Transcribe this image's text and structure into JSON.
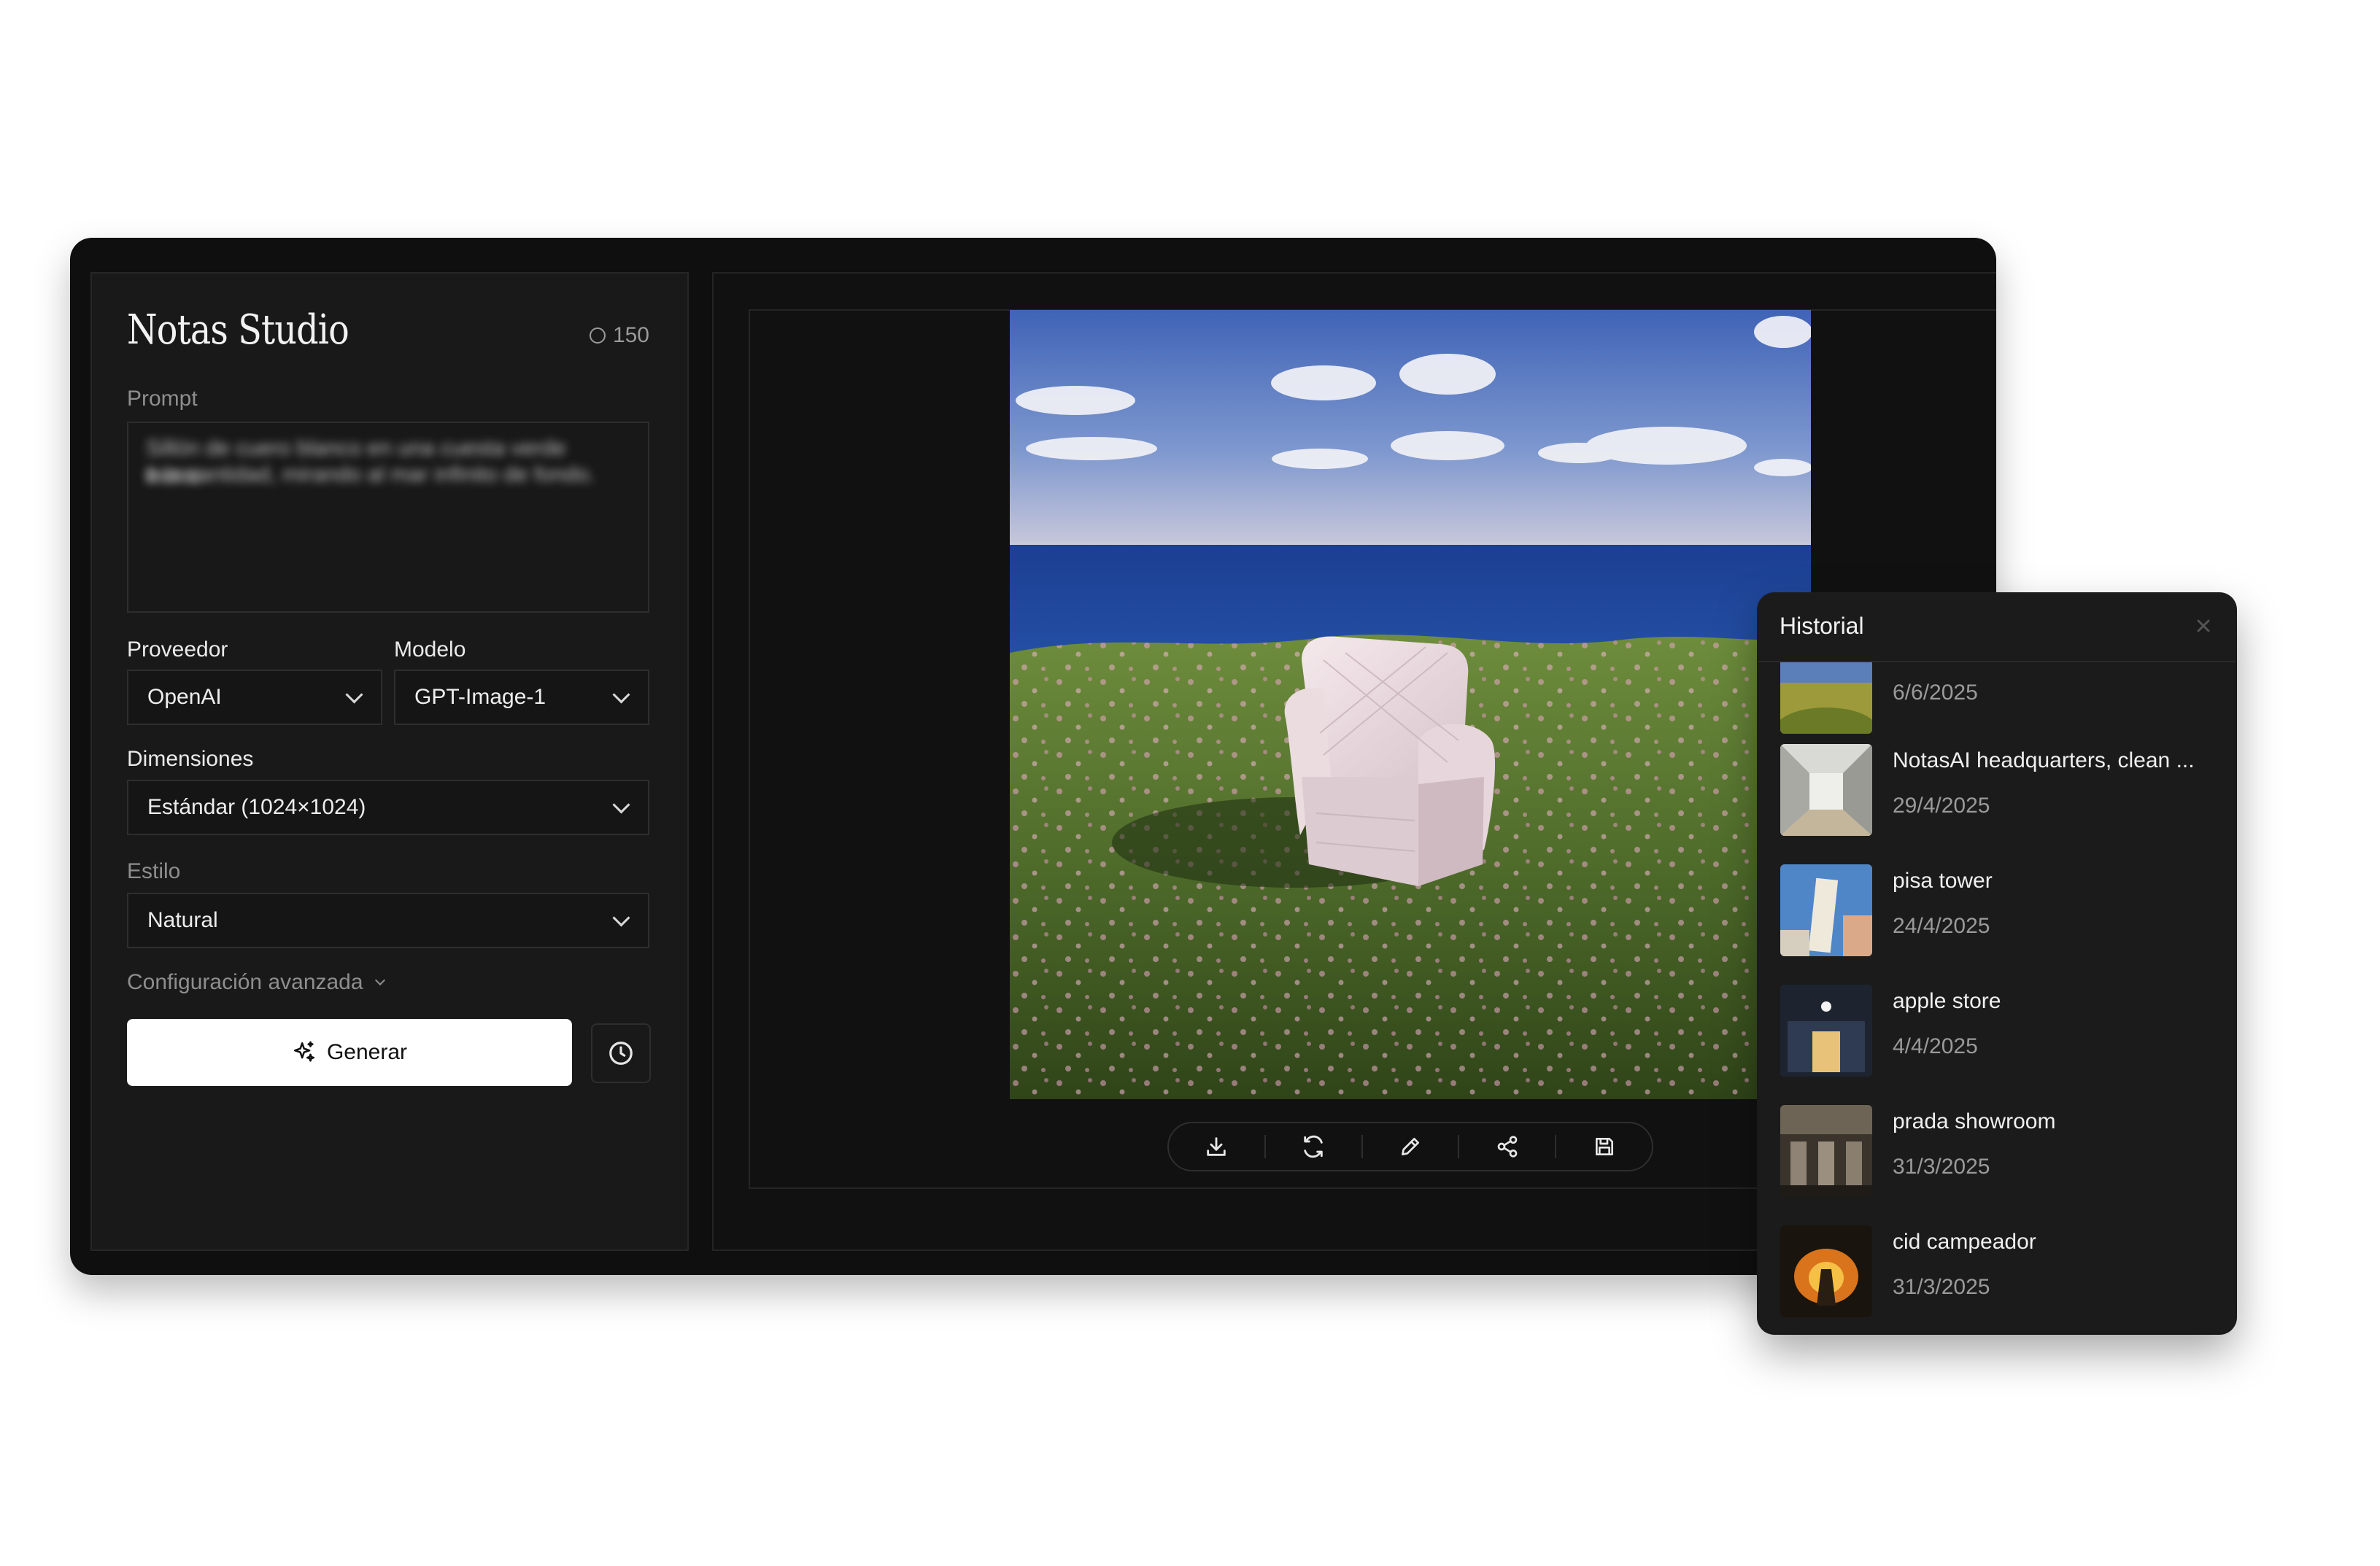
{
  "app": {
    "title": "Notas Studio",
    "credits": "150"
  },
  "form": {
    "prompt_label": "Prompt",
    "prompt_line1": "Sillón de cuero blanco en una cuesta verde frente",
    "prompt_line2": "a la cantidad, mirando al mar infinito de fondo.",
    "provider_label": "Proveedor",
    "provider_value": "OpenAI",
    "model_label": "Modelo",
    "model_value": "GPT-Image-1",
    "dimensions_label": "Dimensiones",
    "dimensions_value": "Estándar (1024×1024)",
    "style_label": "Estilo",
    "style_value": "Natural",
    "advanced_label": "Configuración avanzada",
    "generate_label": "Generar"
  },
  "toolbar": {
    "icons": [
      "download-icon",
      "refresh-icon",
      "edit-icon",
      "share-icon",
      "save-icon"
    ]
  },
  "history": {
    "title": "Historial",
    "items": [
      {
        "name": "",
        "date": "6/6/2025"
      },
      {
        "name": "NotasAI headquarters, clean ...",
        "date": "29/4/2025"
      },
      {
        "name": "pisa tower",
        "date": "24/4/2025"
      },
      {
        "name": "apple store",
        "date": "4/4/2025"
      },
      {
        "name": "prada showroom",
        "date": "31/3/2025"
      },
      {
        "name": "cid campeador",
        "date": "31/3/2025"
      }
    ]
  },
  "colors": {
    "window_bg": "#0f0f0f",
    "panel_bg": "#191919",
    "accent_button": "#ffffff"
  }
}
